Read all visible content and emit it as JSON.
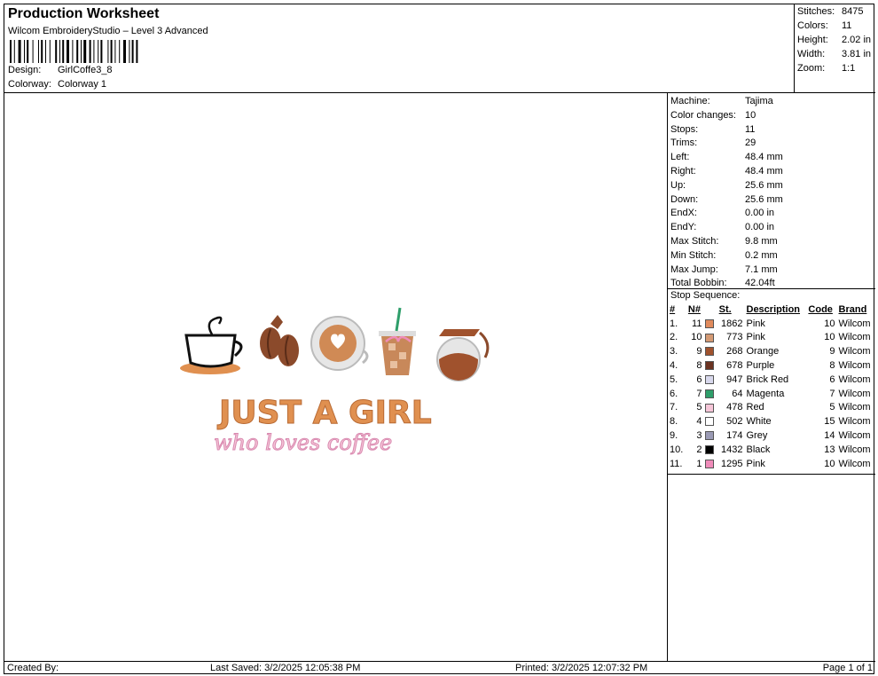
{
  "header": {
    "title": "Production Worksheet",
    "software": "Wilcom EmbroideryStudio – Level 3 Advanced",
    "design_label": "Design:",
    "design_value": "GirlCoffe3_8",
    "colorway_label": "Colorway:",
    "colorway_value": "Colorway 1"
  },
  "summary": [
    {
      "label": "Stitches:",
      "value": "8475"
    },
    {
      "label": "Colors:",
      "value": "11"
    },
    {
      "label": "Height:",
      "value": "2.02 in"
    },
    {
      "label": "Width:",
      "value": "3.81 in"
    },
    {
      "label": "Zoom:",
      "value": "1:1"
    }
  ],
  "machine_info": [
    {
      "label": "Machine:",
      "value": "Tajima"
    },
    {
      "label": "Color changes:",
      "value": "10"
    },
    {
      "label": "Stops:",
      "value": "11"
    },
    {
      "label": "Trims:",
      "value": "29"
    },
    {
      "label": "Left:",
      "value": "48.4 mm"
    },
    {
      "label": "Right:",
      "value": "48.4 mm"
    },
    {
      "label": "Up:",
      "value": "25.6 mm"
    },
    {
      "label": "Down:",
      "value": "25.6 mm"
    },
    {
      "label": "EndX:",
      "value": "0.00 in"
    },
    {
      "label": "EndY:",
      "value": "0.00 in"
    },
    {
      "label": "Max Stitch:",
      "value": "9.8 mm"
    },
    {
      "label": "Min Stitch:",
      "value": "0.2 mm"
    },
    {
      "label": "Max Jump:",
      "value": "7.1 mm"
    },
    {
      "label": "Total Bobbin:",
      "value": "42.04ft"
    }
  ],
  "stop_sequence": {
    "title": "Stop Sequence:",
    "headers": {
      "num": "#",
      "n": "N#",
      "st": "St.",
      "desc": "Description",
      "code": "Code",
      "brand": "Brand"
    },
    "rows": [
      {
        "num": "1.",
        "n": "11",
        "color": "#e08a5c",
        "st": "1862",
        "desc": "Pink",
        "code": "10",
        "brand": "Wilcom"
      },
      {
        "num": "2.",
        "n": "10",
        "color": "#d49a74",
        "st": "773",
        "desc": "Pink",
        "code": "10",
        "brand": "Wilcom"
      },
      {
        "num": "3.",
        "n": "9",
        "color": "#a0522d",
        "st": "268",
        "desc": "Orange",
        "code": "9",
        "brand": "Wilcom"
      },
      {
        "num": "4.",
        "n": "8",
        "color": "#6b3322",
        "st": "678",
        "desc": "Purple",
        "code": "8",
        "brand": "Wilcom"
      },
      {
        "num": "5.",
        "n": "6",
        "color": "#d8d8ec",
        "st": "947",
        "desc": "Brick Red",
        "code": "6",
        "brand": "Wilcom"
      },
      {
        "num": "6.",
        "n": "7",
        "color": "#2e9e6a",
        "st": "64",
        "desc": "Magenta",
        "code": "7",
        "brand": "Wilcom"
      },
      {
        "num": "7.",
        "n": "5",
        "color": "#f6c6d8",
        "st": "478",
        "desc": "Red",
        "code": "5",
        "brand": "Wilcom"
      },
      {
        "num": "8.",
        "n": "4",
        "color": "#ffffff",
        "st": "502",
        "desc": "White",
        "code": "15",
        "brand": "Wilcom"
      },
      {
        "num": "9.",
        "n": "3",
        "color": "#9a9ab4",
        "st": "174",
        "desc": "Grey",
        "code": "14",
        "brand": "Wilcom"
      },
      {
        "num": "10.",
        "n": "2",
        "color": "#000000",
        "st": "1432",
        "desc": "Black",
        "code": "13",
        "brand": "Wilcom"
      },
      {
        "num": "11.",
        "n": "1",
        "color": "#f08cba",
        "st": "1295",
        "desc": "Pink",
        "code": "10",
        "brand": "Wilcom"
      }
    ]
  },
  "design_preview": {
    "line1": "JUST A GIRL",
    "line2": "who loves coffee"
  },
  "footer": {
    "created_by": "Created By:",
    "last_saved": "Last Saved: 3/2/2025 12:05:38 PM",
    "printed": "Printed: 3/2/2025 12:07:32 PM",
    "page": "Page 1 of 1"
  }
}
